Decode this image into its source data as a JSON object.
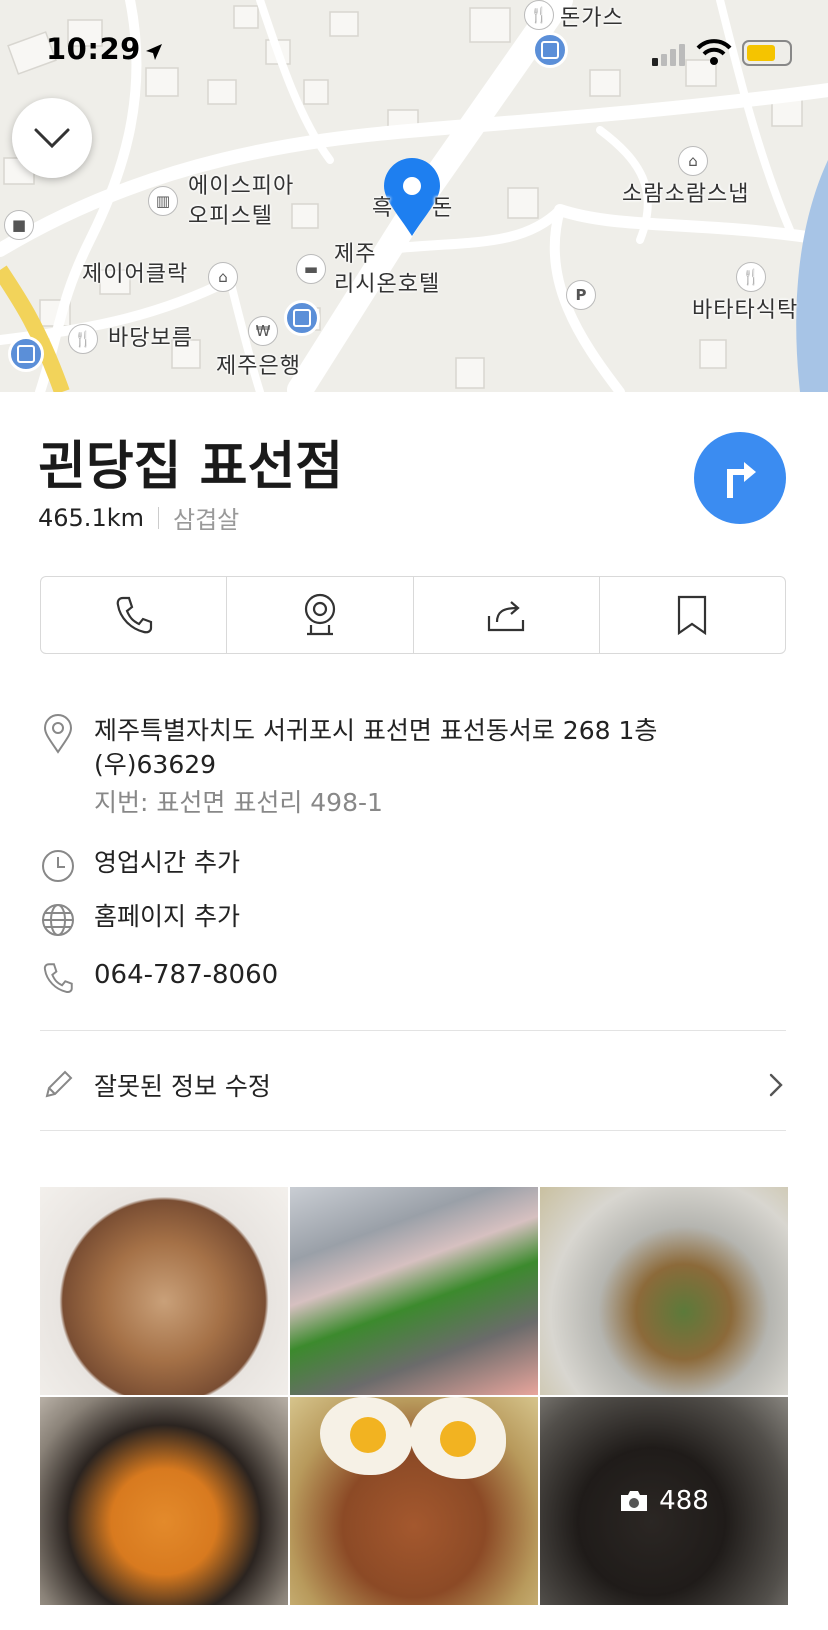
{
  "status_bar": {
    "time": "10:29"
  },
  "map": {
    "labels": {
      "donkas": "돈가스",
      "espia": "에이스피아",
      "espia2": "오피스텔",
      "heuk": "흑",
      "heuk2": "돈",
      "jeju_resi": "제주",
      "jeju_resi2": "리시온호텔",
      "soram": "소람소람스냅",
      "jayer": "제이어클락",
      "badang": "바당보름",
      "jeju_bank": "제주은행",
      "batata": "바타타식탁"
    }
  },
  "place": {
    "name": "괸당집 표선점",
    "distance": "465.1km",
    "category": "삼겹살"
  },
  "info": {
    "address": "제주특별자치도 서귀포시 표선면 표선동서로 268 1층",
    "postal": "(우)63629",
    "jibun": "지번: 표선면 표선리 498-1",
    "hours_link": "영업시간 추가",
    "homepage_link": "홈페이지 추가",
    "phone": "064-787-8060",
    "edit_label": "잘못된 정보 수정"
  },
  "photos": {
    "count": "488"
  },
  "colors": {
    "accent": "#3b8cf1",
    "link": "#2f85e6",
    "pin": "#1e7ff0"
  },
  "icons": [
    "location-arrow-icon",
    "signal-icon",
    "wifi-icon",
    "battery-icon",
    "chevron-down-icon",
    "route-icon",
    "phone-icon",
    "street-view-icon",
    "share-icon",
    "bookmark-icon",
    "pin-icon",
    "clock-icon",
    "globe-icon",
    "pencil-icon",
    "chevron-right-icon",
    "camera-icon"
  ]
}
